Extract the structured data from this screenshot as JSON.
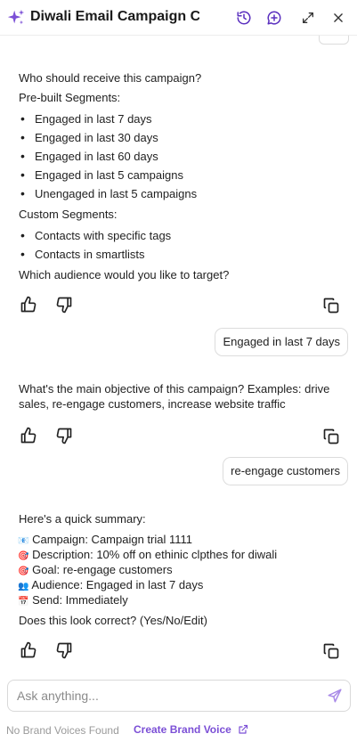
{
  "header": {
    "title": "Diwali Email Campaign C...",
    "icons": [
      "sparkle-icon",
      "history-icon",
      "new-chat-icon",
      "expand-icon",
      "close-icon"
    ],
    "accent": "#7b4fd6"
  },
  "messages": {
    "audience": {
      "question": "Who should receive this campaign?",
      "prebuilt_heading": "Pre-built Segments:",
      "prebuilt": [
        "Engaged in last 7 days",
        "Engaged in last 30 days",
        "Engaged in last 60 days",
        "Engaged in last 5 campaigns",
        "Unengaged in last 5 campaigns"
      ],
      "custom_heading": "Custom Segments:",
      "custom": [
        "Contacts with specific tags",
        "Contacts in smartlists"
      ],
      "prompt": "Which audience would you like to target?"
    },
    "user_reply_1": "Engaged in last 7 days",
    "objective": {
      "line1": "What's the main objective of this campaign? Examples: drive",
      "line2": "sales, re-engage customers, increase website traffic"
    },
    "user_reply_2": "re-engage customers",
    "summary": {
      "heading": "Here's a quick summary:",
      "items": [
        {
          "emoji": "📧",
          "text": "Campaign: Campaign trial 1111"
        },
        {
          "emoji": "🎯",
          "text": "Description: 10% off on ethinic clpthes for diwali"
        },
        {
          "emoji": "🎯",
          "text": "Goal: re-engage customers"
        },
        {
          "emoji": "👥",
          "text": "Audience: Engaged in last 7 days"
        },
        {
          "emoji": "📅",
          "text": "Send: Immediately"
        }
      ],
      "confirm": "Does this look correct? (Yes/No/Edit)"
    }
  },
  "composer": {
    "placeholder": "Ask anything..."
  },
  "footer": {
    "status": "No Brand Voices Found",
    "link": "Create Brand Voice"
  }
}
